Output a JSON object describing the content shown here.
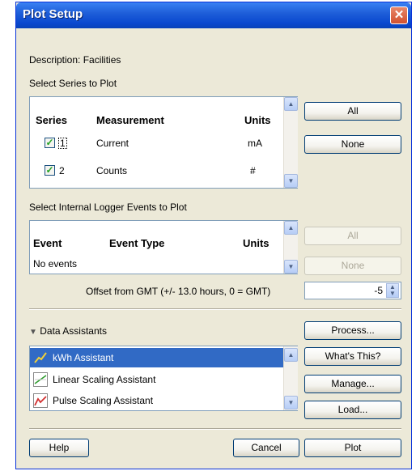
{
  "dialog": {
    "title": "Plot Setup",
    "close_glyph": "✕"
  },
  "description": "Description: Facilities",
  "series_section": {
    "heading": "Select Series to Plot",
    "columns": [
      "Series",
      "Measurement",
      "Units"
    ],
    "rows": [
      {
        "checked": true,
        "series": "1",
        "measurement": "Current",
        "units": "mA"
      },
      {
        "checked": true,
        "series": "2",
        "measurement": "Counts",
        "units": "#"
      }
    ],
    "all_button": "All",
    "none_button": "None"
  },
  "events_section": {
    "heading": "Select Internal Logger Events to Plot",
    "columns": [
      "Event",
      "Event Type",
      "Units"
    ],
    "empty_text": "No events",
    "all_button": "All",
    "none_button": "None"
  },
  "offset": {
    "label": "Offset from GMT (+/- 13.0 hours, 0 = GMT)",
    "value": "-5"
  },
  "assistants": {
    "heading": "Data Assistants",
    "items": [
      {
        "label": "kWh Assistant",
        "selected": true,
        "icon": "kwh-chart-icon"
      },
      {
        "label": "Linear Scaling Assistant",
        "selected": false,
        "icon": "linear-chart-icon"
      },
      {
        "label": "Pulse Scaling Assistant",
        "selected": false,
        "icon": "pulse-chart-icon"
      }
    ],
    "buttons": {
      "process": "Process...",
      "whats_this": "What's This?",
      "manage": "Manage...",
      "load": "Load..."
    }
  },
  "footer": {
    "help": "Help",
    "cancel": "Cancel",
    "plot": "Plot"
  },
  "colors": {
    "title_bar": "#0a48cf",
    "selection": "#316ac5",
    "check": "#21a121",
    "close": "#d2512f"
  }
}
